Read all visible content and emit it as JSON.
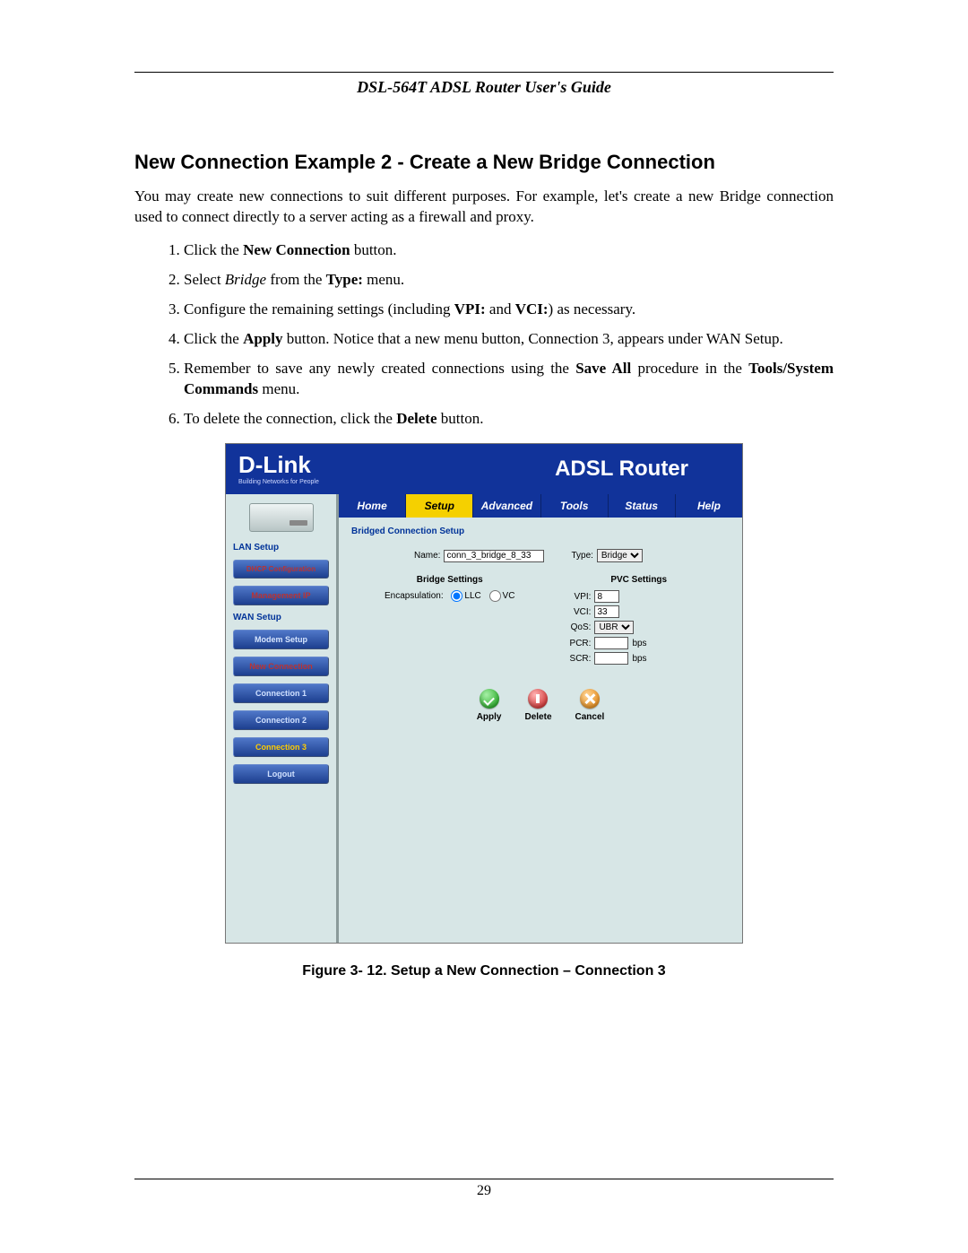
{
  "header": {
    "title": "DSL-564T ADSL Router User's Guide"
  },
  "section": {
    "title": "New Connection Example 2 - Create a New Bridge Connection",
    "intro": "You may create new connections to suit different purposes. For example, let's create a new Bridge connection used to connect directly to a server acting as a firewall and proxy.",
    "steps": {
      "s1a": "Click the ",
      "s1b": "New Connection",
      "s1c": " button.",
      "s2a": "Select ",
      "s2b": "Bridge",
      "s2c": " from the ",
      "s2d": "Type:",
      "s2e": " menu.",
      "s3a": "Configure the remaining settings (including ",
      "s3b": "VPI:",
      "s3c": " and ",
      "s3d": "VCI:",
      "s3e": ") as necessary.",
      "s4a": "Click the ",
      "s4b": "Apply",
      "s4c": " button. Notice that a new menu button, Connection 3, appears under WAN Setup.",
      "s5a": "Remember to save any newly created connections using the ",
      "s5b": "Save All",
      "s5c": " procedure in the ",
      "s5d": "Tools/System Commands",
      "s5e": " menu.",
      "s6a": "To delete the connection, click the ",
      "s6b": "Delete",
      "s6c": " button."
    }
  },
  "figure": {
    "caption": "Figure 3- 12. Setup a New Connection – Connection 3"
  },
  "footer": {
    "page": "29"
  },
  "router": {
    "logo": {
      "main": "D-Link",
      "sub": "Building Networks for People"
    },
    "banner": "ADSL Router",
    "tabs": [
      "Home",
      "Setup",
      "Advanced",
      "Tools",
      "Status",
      "Help"
    ],
    "sidebar": {
      "lan": "LAN Setup",
      "dhcp": "DHCP Configuration",
      "mgmt": "Management IP",
      "wan": "WAN Setup",
      "modem": "Modem Setup",
      "newconn": "New Connection",
      "c1": "Connection 1",
      "c2": "Connection 2",
      "c3": "Connection 3",
      "logout": "Logout"
    },
    "form": {
      "title": "Bridged Connection Setup",
      "name_lbl": "Name:",
      "name_val": "conn_3_bridge_8_33",
      "type_lbl": "Type:",
      "type_val": "Bridge",
      "bridge_title": "Bridge Settings",
      "enc_lbl": "Encapsulation:",
      "enc_llc": "LLC",
      "enc_vc": "VC",
      "pvc_title": "PVC Settings",
      "vpi_lbl": "VPI:",
      "vpi_val": "8",
      "vci_lbl": "VCI:",
      "vci_val": "33",
      "qos_lbl": "QoS:",
      "qos_val": "UBR",
      "pcr_lbl": "PCR:",
      "pcr_val": "",
      "bps": "bps",
      "scr_lbl": "SCR:",
      "scr_val": "",
      "apply": "Apply",
      "delete": "Delete",
      "cancel": "Cancel"
    }
  }
}
